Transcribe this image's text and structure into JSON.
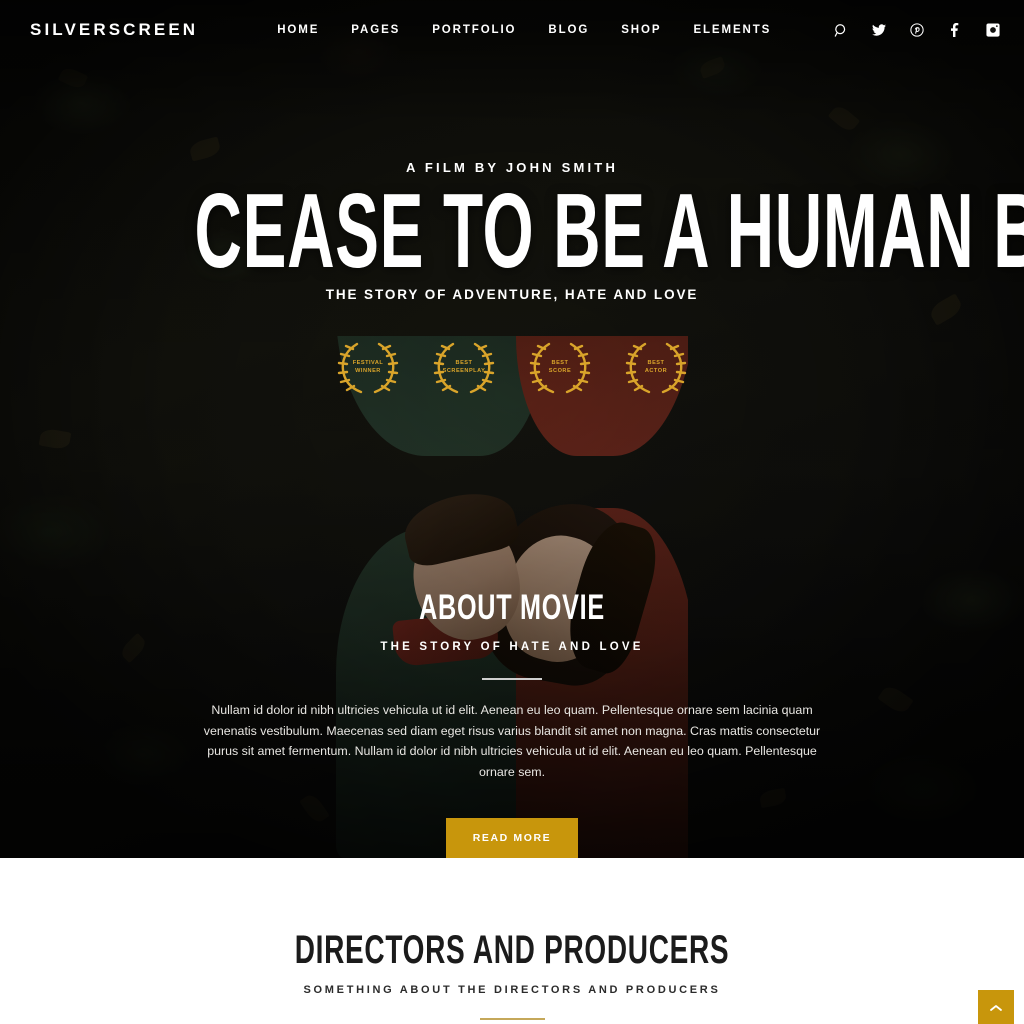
{
  "theme": {
    "gold": "#C8960C",
    "gold_light": "#D9A42A",
    "dark": "#121210",
    "text_light": "#ffffff",
    "divider_light": "#cfcfcf",
    "divider_gold": "#C5A85A"
  },
  "header": {
    "logo": "SILVERSCREEN",
    "nav": [
      {
        "label": "HOME"
      },
      {
        "label": "PAGES"
      },
      {
        "label": "PORTFOLIO"
      },
      {
        "label": "BLOG"
      },
      {
        "label": "SHOP"
      },
      {
        "label": "ELEMENTS"
      }
    ],
    "social": [
      {
        "icon": "search-icon"
      },
      {
        "icon": "twitter-icon"
      },
      {
        "icon": "pinterest-icon"
      },
      {
        "icon": "facebook-icon"
      },
      {
        "icon": "instagram-icon"
      }
    ]
  },
  "hero": {
    "eyebrow": "A FILM BY JOHN SMITH",
    "title": "CEASE TO BE A HUMAN BEING",
    "subtitle": "THE STORY OF ADVENTURE, HATE AND LOVE",
    "awards": [
      {
        "line1": "FESTIVAL",
        "line2": "WINNER"
      },
      {
        "line1": "BEST",
        "line2": "SCREENPLAY"
      },
      {
        "line1": "BEST",
        "line2": "SCORE"
      },
      {
        "line1": "BEST",
        "line2": "ACTOR"
      }
    ]
  },
  "about": {
    "title": "ABOUT MOVIE",
    "subtitle": "THE STORY OF HATE AND LOVE",
    "body": "Nullam id dolor id nibh ultricies vehicula ut id elit. Aenean eu leo quam. Pellentesque ornare sem lacinia quam venenatis vestibulum. Maecenas sed diam eget risus varius blandit sit amet non magna. Cras mattis consectetur purus sit amet fermentum. Nullam id dolor id nibh ultricies vehicula ut id elit. Aenean eu leo quam. Pellentesque ornare sem.",
    "button_label": "READ MORE"
  },
  "directors": {
    "title": "DIRECTORS AND PRODUCERS",
    "subtitle": "SOMETHING ABOUT THE DIRECTORS AND PRODUCERS"
  },
  "scroll_top": {
    "icon": "chevron-up-icon"
  }
}
